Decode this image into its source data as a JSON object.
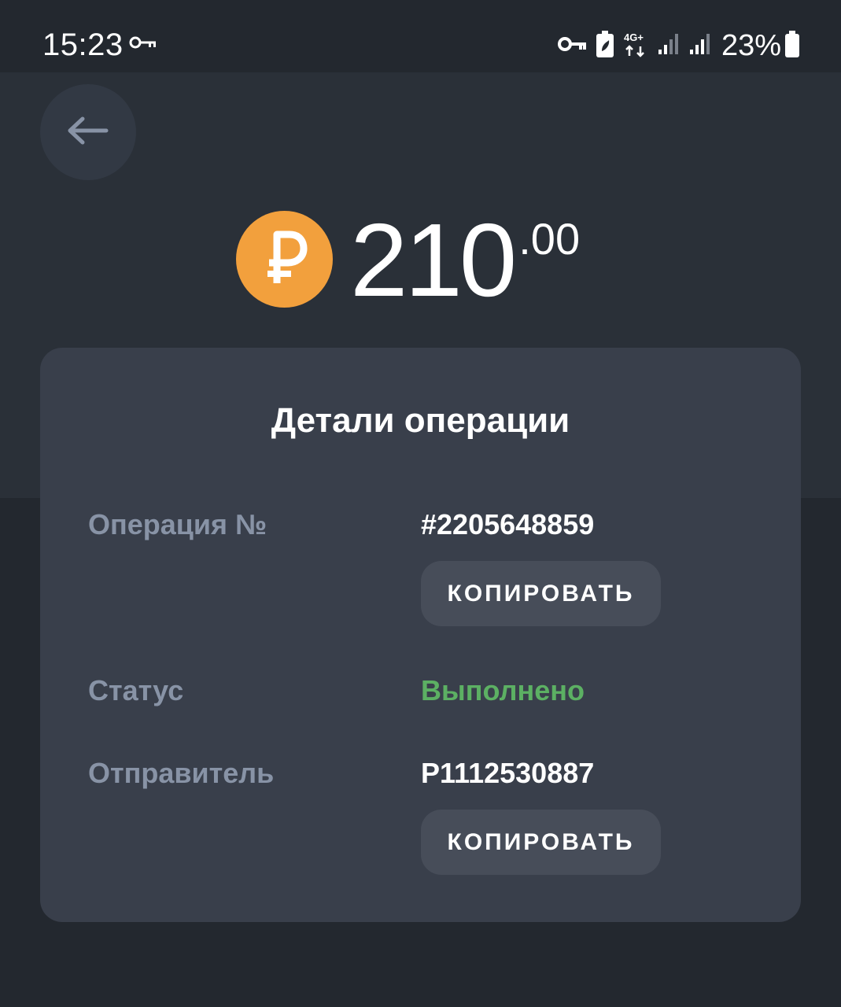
{
  "status_bar": {
    "time": "15:23",
    "battery_percent": "23%",
    "network_label": "4G+",
    "icons": [
      "vpn-key-icon",
      "vpn-key-icon",
      "battery-saver-icon",
      "network-4g-icon",
      "signal-icon",
      "signal-icon",
      "battery-icon"
    ]
  },
  "header": {
    "back_icon": "arrow-left-icon"
  },
  "amount": {
    "currency_icon": "ruble-coin-icon",
    "integer": "210",
    "fraction": ".00"
  },
  "details": {
    "title": "Детали операции",
    "rows": [
      {
        "label": "Операция №",
        "value": "#2205648859",
        "copy_label": "КОПИРОВАТЬ"
      },
      {
        "label": "Статус",
        "value": "Выполнено"
      },
      {
        "label": "Отправитель",
        "value": "P1112530887",
        "copy_label": "КОПИРОВАТЬ"
      }
    ]
  },
  "colors": {
    "background": "#23282f",
    "header_band": "#2a3038",
    "card": "#393f4b",
    "button": "#474d59",
    "label": "#8893a6",
    "success": "#5cb063",
    "coin": "#f2a03d"
  }
}
